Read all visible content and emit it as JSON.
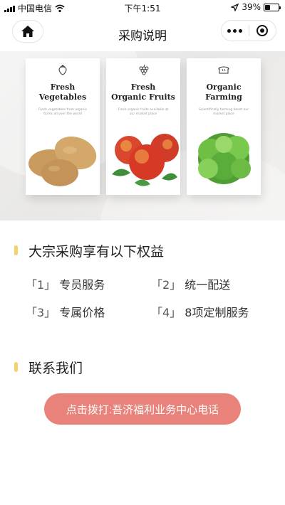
{
  "status_bar": {
    "carrier": "中国电信",
    "time": "下午1:51",
    "battery_percent": "39%",
    "battery_level": 0.39,
    "icons": [
      "signal-icon",
      "wifi-icon",
      "location-arrow-icon",
      "battery-icon"
    ]
  },
  "nav": {
    "title": "采购说明",
    "home_icon": "home-icon",
    "more_icon": "more-dots-icon",
    "close_icon": "target-circle-icon"
  },
  "banner": {
    "cards": [
      {
        "title_line1": "Fresh",
        "title_line2": "Vegetables",
        "subtitle": "Fresh vegetables from organic farms all over the world",
        "icon": "strawberry-icon",
        "art": "potatoes"
      },
      {
        "title_line1": "Fresh",
        "title_line2": "Organic Fruits",
        "subtitle": "Fresh organic fruits available at our market place",
        "icon": "grapes-icon",
        "art": "peaches"
      },
      {
        "title_line1": "Organic",
        "title_line2": "Farming",
        "subtitle": "Scientifically farming boost our market place",
        "icon": "bread-icon",
        "art": "lettuce"
      }
    ]
  },
  "benefits": {
    "title": "大宗采购享有以下权益",
    "items": [
      {
        "num": "「1」",
        "label": "专员服务"
      },
      {
        "num": "「2」",
        "label": "统一配送"
      },
      {
        "num": "「3」",
        "label": "专属价格"
      },
      {
        "num": "「4」",
        "label": "8项定制服务"
      }
    ]
  },
  "contact": {
    "title": "联系我们",
    "call_button": "点击拨打:吾济福利业务中心电话"
  },
  "colors": {
    "accent_bar": "#f2d36b",
    "call_button": "#e9827a"
  }
}
